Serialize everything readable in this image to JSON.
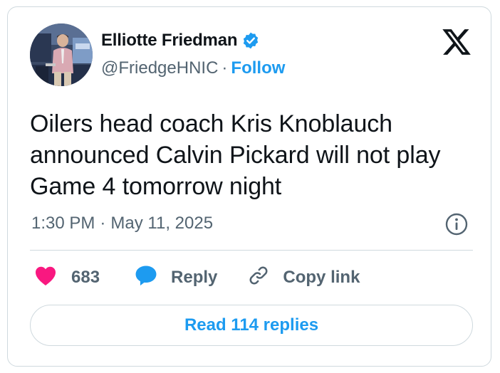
{
  "author": {
    "display_name": "Elliotte Friedman",
    "handle": "@FriedgeHNIC",
    "separator": "·",
    "follow_label": "Follow",
    "verified": true,
    "avatar_icon": "person-photo-avatar"
  },
  "brand": {
    "logo_icon": "x-logo-icon"
  },
  "tweet": {
    "text": "Oilers head coach Kris Knoblauch announced Calvin Pickard will not play Game 4 tomorrow night",
    "time": "1:30 PM",
    "separator": "·",
    "date": "May 11, 2025"
  },
  "actions": {
    "like_count": "683",
    "reply_label": "Reply",
    "copy_label": "Copy link"
  },
  "read_replies_label": "Read 114 replies",
  "colors": {
    "accent": "#1d9bf0",
    "like": "#f91880",
    "text_primary": "#0f1419",
    "text_secondary": "#536471",
    "border": "#cfd9de"
  }
}
